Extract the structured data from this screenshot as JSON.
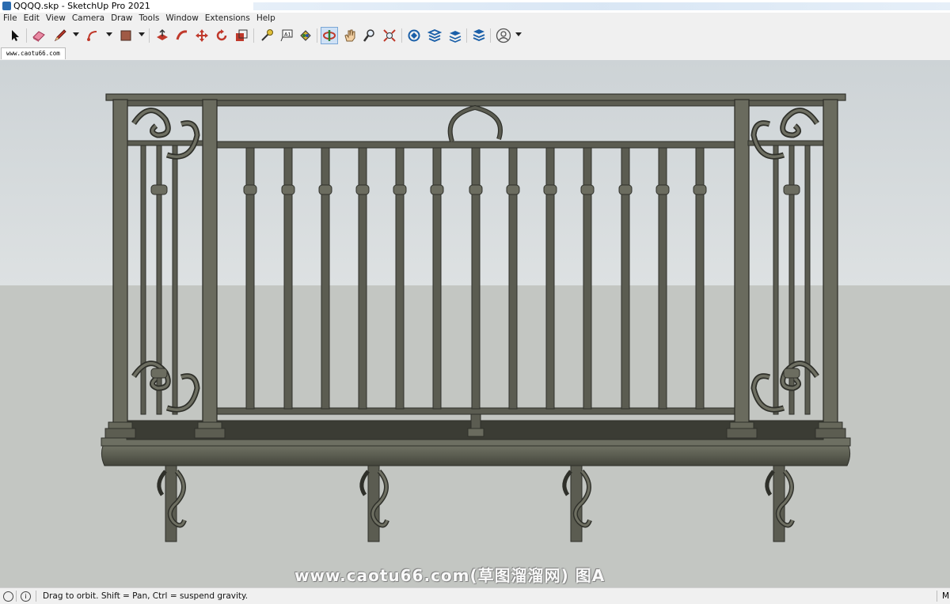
{
  "window": {
    "title": "QQQQ.skp - SketchUp Pro 2021"
  },
  "menu": [
    "File",
    "Edit",
    "View",
    "Camera",
    "Draw",
    "Tools",
    "Window",
    "Extensions",
    "Help"
  ],
  "toolbar": {
    "tools": [
      {
        "name": "select-tool",
        "icon": "arrow-cursor-icon"
      },
      {
        "name": "eraser-tool",
        "icon": "eraser-icon"
      },
      {
        "name": "line-tool",
        "icon": "pencil-icon"
      },
      {
        "name": "arc-tool",
        "icon": "arc-icon"
      },
      {
        "name": "rectangle-tool",
        "icon": "rectangle-icon"
      },
      {
        "name": "push-pull-tool",
        "icon": "push-pull-icon"
      },
      {
        "name": "follow-me-tool",
        "icon": "follow-me-icon"
      },
      {
        "name": "move-tool",
        "icon": "move-icon"
      },
      {
        "name": "rotate-tool",
        "icon": "rotate-icon"
      },
      {
        "name": "scale-tool",
        "icon": "scale-icon"
      },
      {
        "name": "tape-measure-tool",
        "icon": "tape-measure-icon"
      },
      {
        "name": "text-tool",
        "icon": "text-icon",
        "label": "A1"
      },
      {
        "name": "paint-bucket-tool",
        "icon": "paint-bucket-icon"
      },
      {
        "name": "orbit-tool",
        "icon": "orbit-icon",
        "active": true
      },
      {
        "name": "pan-tool",
        "icon": "hand-icon"
      },
      {
        "name": "zoom-tool",
        "icon": "magnifier-icon"
      },
      {
        "name": "zoom-extents-tool",
        "icon": "zoom-extents-icon"
      },
      {
        "name": "3d-warehouse-button",
        "icon": "warehouse-icon"
      },
      {
        "name": "extension-warehouse-button",
        "icon": "extension-icon"
      },
      {
        "name": "layout-button",
        "icon": "layout-icon"
      },
      {
        "name": "extension-manager-button",
        "icon": "extension-manager-icon"
      },
      {
        "name": "account-button",
        "icon": "user-account-icon"
      }
    ]
  },
  "scene_tab": {
    "label": "www.caotu66.com"
  },
  "status": {
    "message": "Drag to orbit. Shift = Pan, Ctrl = suspend gravity.",
    "measurements_label": "M"
  },
  "watermark": {
    "text": "www.caotu66.com(草图溜溜网) 图A"
  },
  "colors": {
    "sky": "#d5dadc",
    "ground": "#c3c6c2",
    "iron": "#5b5c51",
    "iron_dark": "#2f302a",
    "accent_active": "#cfe1f5"
  }
}
